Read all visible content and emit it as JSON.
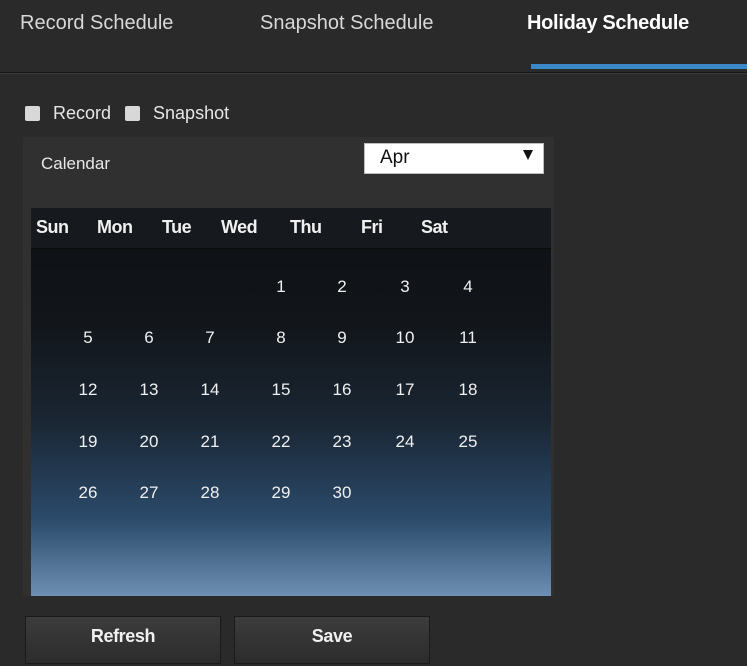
{
  "tabs": [
    {
      "label": "Record Schedule",
      "active": false
    },
    {
      "label": "Snapshot Schedule",
      "active": false
    },
    {
      "label": "Holiday Schedule",
      "active": true
    }
  ],
  "checkboxes": {
    "record_label": "Record",
    "snapshot_label": "Snapshot",
    "record_checked": false,
    "snapshot_checked": false
  },
  "calendar": {
    "title": "Calendar",
    "month_selected": "Apr",
    "weekdays": [
      "Sun",
      "Mon",
      "Tue",
      "Wed",
      "Thu",
      "Fri",
      "Sat"
    ],
    "days": [
      [
        "",
        "",
        "",
        "1",
        "2",
        "3",
        "4"
      ],
      [
        "5",
        "6",
        "7",
        "8",
        "9",
        "10",
        "11"
      ],
      [
        "12",
        "13",
        "14",
        "15",
        "16",
        "17",
        "18"
      ],
      [
        "19",
        "20",
        "21",
        "22",
        "23",
        "24",
        "25"
      ],
      [
        "26",
        "27",
        "28",
        "29",
        "30",
        "",
        ""
      ]
    ]
  },
  "buttons": {
    "refresh_label": "Refresh",
    "save_label": "Save"
  },
  "colors": {
    "active_tab_underline": "#3b88c9",
    "background": "#2a2a2a"
  }
}
